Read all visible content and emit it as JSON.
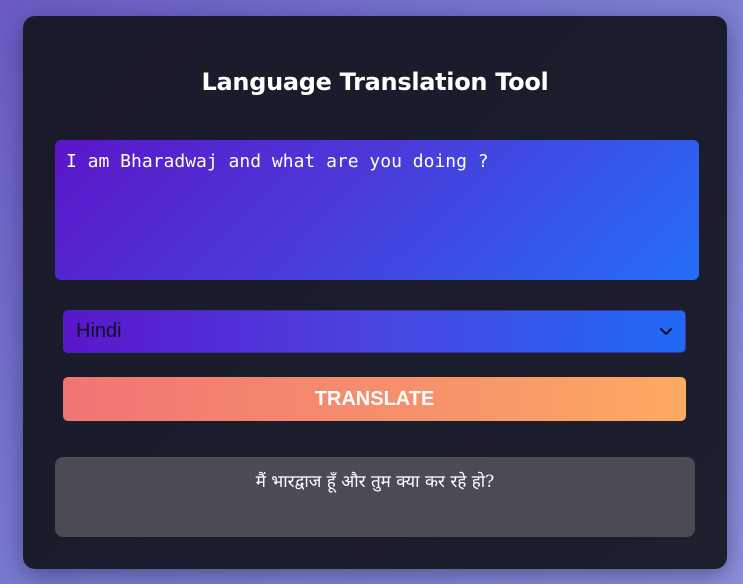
{
  "app": {
    "title": "Language Translation Tool"
  },
  "input": {
    "value": "I am Bharadwaj and what are you doing ?"
  },
  "language_select": {
    "selected": "Hindi",
    "icon": "chevron-down-icon"
  },
  "translate_button": {
    "label": "TRANSLATE"
  },
  "output": {
    "text": "मैं भारद्वाज हूँ और तुम क्या कर रहे हो?"
  },
  "colors": {
    "page_bg": "#7a7fd0",
    "card_bg": "#1a1b2b",
    "input_gradient_start": "#5b16c9",
    "input_gradient_end": "#246ef7",
    "button_gradient_start": "#f17474",
    "button_gradient_end": "#fdaa62",
    "output_bg": "#4b4b55"
  }
}
